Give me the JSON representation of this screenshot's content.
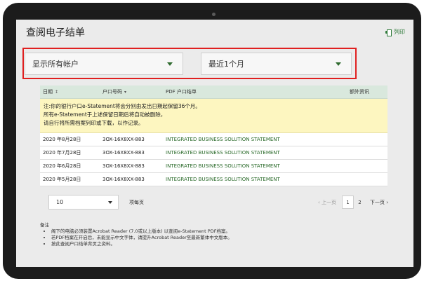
{
  "page": {
    "title": "查阅电子结单",
    "print_label": "列印"
  },
  "filters": {
    "account": "显示所有帐户",
    "period": "最近1个月"
  },
  "table": {
    "headers": {
      "date": "日期",
      "account": "户口号码",
      "pdf": "PDF 户口结单",
      "extra": "额外资讯"
    },
    "notice": [
      "注:你的银行户口e-Statement将会分别由发出日期起保留36个月。",
      "所有e-Statement于上述保留日期后将自动被删除，",
      "请自行将所需档案列印或下载，以作记录。"
    ],
    "rows": [
      {
        "date": "2020 年8月28日",
        "account": "3OX-16X8XX-883",
        "pdf": "INTEGRATED BUSINESS SOLUTION STATEMENT"
      },
      {
        "date": "2020 年7月28日",
        "account": "3OX-16X8XX-883",
        "pdf": "INTEGRATED BUSINESS SOLUTION STATEMENT"
      },
      {
        "date": "2020 年6月28日",
        "account": "3OX-16X8XX-883",
        "pdf": "INTEGRATED BUSINESS SOLUTION STATEMENT"
      },
      {
        "date": "2020 年5月28日",
        "account": "3OX-16X8XX-883",
        "pdf": "INTEGRATED BUSINESS SOLUTION STATEMENT"
      }
    ]
  },
  "pagination": {
    "page_size": "10",
    "per_page_label": "项每页",
    "prev": "‹ 上一页",
    "pages": [
      "1",
      "2"
    ],
    "current": "1",
    "next": "下一页 ›"
  },
  "notes": {
    "title": "备注",
    "items": [
      "阁下的电脑必须装置Acrobat Reader (7.0或以上版本) 以查阅e-Statement PDF档案。",
      "若PDF档案在开启后，未能显示中文字体，请提升Acrobat Reader至最新繁体中文版本。",
      "按此查阅户口结单背页之资料。"
    ]
  }
}
